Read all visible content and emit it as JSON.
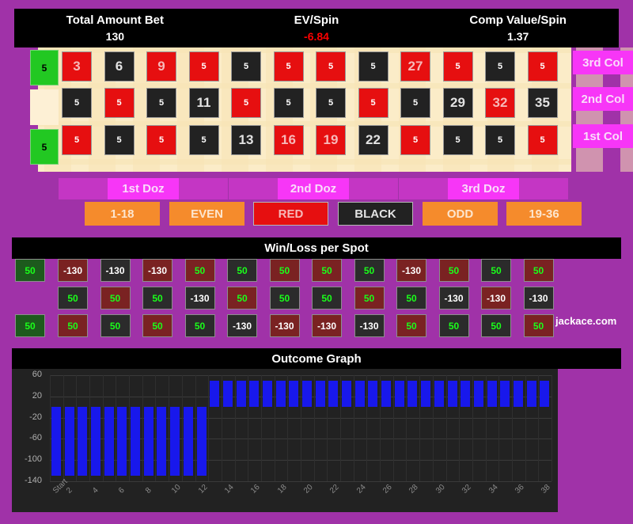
{
  "summary": {
    "items": [
      {
        "label": "Total Amount Bet",
        "value": "130",
        "negative": false
      },
      {
        "label": "EV/Spin",
        "value": "-6.84",
        "negative": true
      },
      {
        "label": "Comp Value/Spin",
        "value": "1.37",
        "negative": false
      }
    ]
  },
  "board": {
    "zeros": [
      {
        "bet": "5",
        "present": true
      },
      {
        "bet": "",
        "present": false
      },
      {
        "bet": "5",
        "present": true
      }
    ],
    "rows": [
      {
        "col_label": "3rd Col",
        "cells": [
          {
            "color": "red",
            "display": "3",
            "is_number": true
          },
          {
            "color": "black",
            "display": "6",
            "is_number": true
          },
          {
            "color": "red",
            "display": "9",
            "is_number": true
          },
          {
            "color": "red",
            "display": "5",
            "is_number": false
          },
          {
            "color": "black",
            "display": "5",
            "is_number": false
          },
          {
            "color": "red",
            "display": "5",
            "is_number": false
          },
          {
            "color": "red",
            "display": "5",
            "is_number": false
          },
          {
            "color": "black",
            "display": "5",
            "is_number": false
          },
          {
            "color": "red",
            "display": "27",
            "is_number": true
          },
          {
            "color": "red",
            "display": "5",
            "is_number": false
          },
          {
            "color": "black",
            "display": "5",
            "is_number": false
          },
          {
            "color": "red",
            "display": "5",
            "is_number": false
          }
        ]
      },
      {
        "col_label": "2nd Col",
        "cells": [
          {
            "color": "black",
            "display": "5",
            "is_number": false
          },
          {
            "color": "red",
            "display": "5",
            "is_number": false
          },
          {
            "color": "black",
            "display": "5",
            "is_number": false
          },
          {
            "color": "black",
            "display": "11",
            "is_number": true
          },
          {
            "color": "red",
            "display": "5",
            "is_number": false
          },
          {
            "color": "black",
            "display": "5",
            "is_number": false
          },
          {
            "color": "black",
            "display": "5",
            "is_number": false
          },
          {
            "color": "red",
            "display": "5",
            "is_number": false
          },
          {
            "color": "black",
            "display": "5",
            "is_number": false
          },
          {
            "color": "black",
            "display": "29",
            "is_number": true
          },
          {
            "color": "red",
            "display": "32",
            "is_number": true
          },
          {
            "color": "black",
            "display": "35",
            "is_number": true
          }
        ]
      },
      {
        "col_label": "1st Col",
        "cells": [
          {
            "color": "red",
            "display": "5",
            "is_number": false
          },
          {
            "color": "black",
            "display": "5",
            "is_number": false
          },
          {
            "color": "red",
            "display": "5",
            "is_number": false
          },
          {
            "color": "black",
            "display": "5",
            "is_number": false
          },
          {
            "color": "black",
            "display": "13",
            "is_number": true
          },
          {
            "color": "red",
            "display": "16",
            "is_number": true
          },
          {
            "color": "red",
            "display": "19",
            "is_number": true
          },
          {
            "color": "black",
            "display": "22",
            "is_number": true
          },
          {
            "color": "red",
            "display": "5",
            "is_number": false
          },
          {
            "color": "black",
            "display": "5",
            "is_number": false
          },
          {
            "color": "black",
            "display": "5",
            "is_number": false
          },
          {
            "color": "red",
            "display": "5",
            "is_number": false
          }
        ]
      }
    ]
  },
  "dozens": [
    {
      "label": "1st Doz"
    },
    {
      "label": "2nd Doz"
    },
    {
      "label": "3rd Doz"
    }
  ],
  "outside": [
    {
      "label": "1-18",
      "style": "orange"
    },
    {
      "label": "EVEN",
      "style": "orange"
    },
    {
      "label": "RED",
      "style": "red"
    },
    {
      "label": "BLACK",
      "style": "black"
    },
    {
      "label": "ODD",
      "style": "orange"
    },
    {
      "label": "19-36",
      "style": "orange"
    }
  ],
  "winloss": {
    "title": "Win/Loss per Spot",
    "watermark": "jackace.com",
    "zeros": [
      {
        "value": "50",
        "tone": "dgreen",
        "result": "win",
        "present": true
      },
      {
        "value": "",
        "tone": "",
        "result": "",
        "present": false
      },
      {
        "value": "50",
        "tone": "dgreen",
        "result": "win",
        "present": true
      }
    ],
    "rows": [
      {
        "cells": [
          {
            "value": "-130",
            "tone": "dred",
            "result": "loss"
          },
          {
            "value": "-130",
            "tone": "dgray",
            "result": "loss"
          },
          {
            "value": "-130",
            "tone": "dred",
            "result": "loss"
          },
          {
            "value": "50",
            "tone": "dred",
            "result": "win"
          },
          {
            "value": "50",
            "tone": "dgray",
            "result": "win"
          },
          {
            "value": "50",
            "tone": "dred",
            "result": "win"
          },
          {
            "value": "50",
            "tone": "dred",
            "result": "win"
          },
          {
            "value": "50",
            "tone": "dgray",
            "result": "win"
          },
          {
            "value": "-130",
            "tone": "dred",
            "result": "loss"
          },
          {
            "value": "50",
            "tone": "dred",
            "result": "win"
          },
          {
            "value": "50",
            "tone": "dgray",
            "result": "win"
          },
          {
            "value": "50",
            "tone": "dred",
            "result": "win"
          }
        ]
      },
      {
        "cells": [
          {
            "value": "50",
            "tone": "dgray",
            "result": "win"
          },
          {
            "value": "50",
            "tone": "dred",
            "result": "win"
          },
          {
            "value": "50",
            "tone": "dgray",
            "result": "win"
          },
          {
            "value": "-130",
            "tone": "dgray",
            "result": "loss"
          },
          {
            "value": "50",
            "tone": "dred",
            "result": "win"
          },
          {
            "value": "50",
            "tone": "dgray",
            "result": "win"
          },
          {
            "value": "50",
            "tone": "dgray",
            "result": "win"
          },
          {
            "value": "50",
            "tone": "dred",
            "result": "win"
          },
          {
            "value": "50",
            "tone": "dgray",
            "result": "win"
          },
          {
            "value": "-130",
            "tone": "dgray",
            "result": "loss"
          },
          {
            "value": "-130",
            "tone": "dred",
            "result": "loss"
          },
          {
            "value": "-130",
            "tone": "dgray",
            "result": "loss"
          }
        ]
      },
      {
        "cells": [
          {
            "value": "50",
            "tone": "dred",
            "result": "win"
          },
          {
            "value": "50",
            "tone": "dgray",
            "result": "win"
          },
          {
            "value": "50",
            "tone": "dred",
            "result": "win"
          },
          {
            "value": "50",
            "tone": "dgray",
            "result": "win"
          },
          {
            "value": "-130",
            "tone": "dgray",
            "result": "loss"
          },
          {
            "value": "-130",
            "tone": "dred",
            "result": "loss"
          },
          {
            "value": "-130",
            "tone": "dred",
            "result": "loss"
          },
          {
            "value": "-130",
            "tone": "dgray",
            "result": "loss"
          },
          {
            "value": "50",
            "tone": "dred",
            "result": "win"
          },
          {
            "value": "50",
            "tone": "dgray",
            "result": "win"
          },
          {
            "value": "50",
            "tone": "dgray",
            "result": "win"
          },
          {
            "value": "50",
            "tone": "dred",
            "result": "win"
          }
        ]
      }
    ]
  },
  "chart_data": {
    "type": "bar",
    "title": "Outcome Graph",
    "xlabel": "",
    "ylabel": "",
    "ylim": [
      -140,
      60
    ],
    "yticks": [
      60,
      20,
      -20,
      -60,
      -100,
      -140
    ],
    "grid": true,
    "legend": null,
    "bar_color": "#1818ec",
    "x": [
      "Start",
      "2",
      "3",
      "4",
      "5",
      "6",
      "7",
      "8",
      "9",
      "10",
      "11",
      "12",
      "13",
      "14",
      "15",
      "16",
      "17",
      "18",
      "19",
      "20",
      "21",
      "22",
      "23",
      "24",
      "25",
      "26",
      "27",
      "28",
      "29",
      "30",
      "31",
      "32",
      "33",
      "34",
      "35",
      "36",
      "37",
      "38"
    ],
    "xticks": [
      "Start",
      "2",
      "4",
      "6",
      "8",
      "10",
      "12",
      "14",
      "16",
      "18",
      "20",
      "22",
      "24",
      "26",
      "28",
      "30",
      "32",
      "34",
      "36",
      "38"
    ],
    "values": [
      -130,
      -130,
      -130,
      -130,
      -130,
      -130,
      -130,
      -130,
      -130,
      -130,
      -130,
      -130,
      50,
      50,
      50,
      50,
      50,
      50,
      50,
      50,
      50,
      50,
      50,
      50,
      50,
      50,
      50,
      50,
      50,
      50,
      50,
      50,
      50,
      50,
      50,
      50,
      50,
      50
    ]
  }
}
